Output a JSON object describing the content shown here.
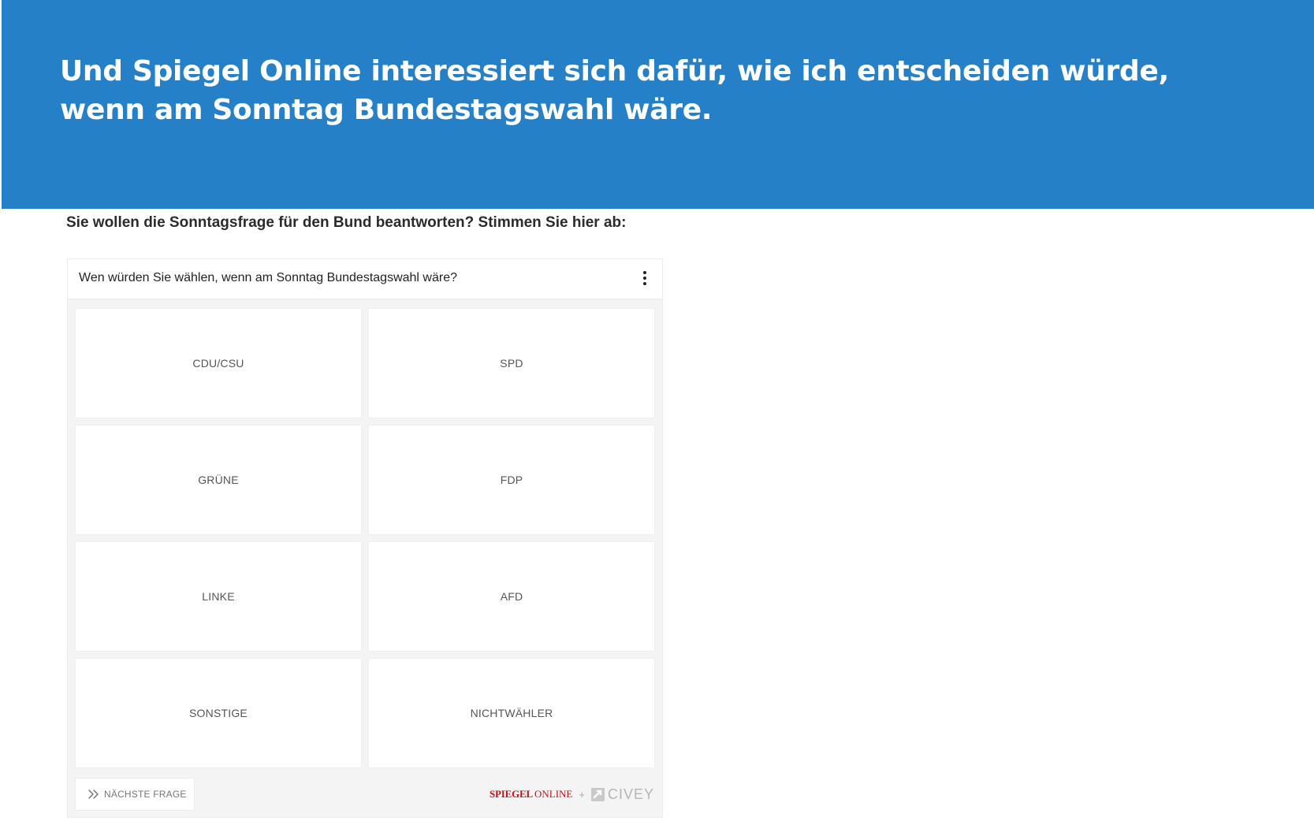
{
  "slide": {
    "title": "Und Spiegel Online interessiert sich dafür, wie ich entscheiden würde, wenn am Sonntag Bundestagswahl wäre.",
    "intro": "Sie wollen die Sonntagsfrage für den Bund beantworten? Stimmen Sie hier ab:",
    "banner_color": "#2580c8"
  },
  "poll": {
    "question": "Wen würden Sie wählen, wenn am Sonntag Bundestagswahl wäre?",
    "menu_icon": "more-vertical-icon",
    "options": [
      "CDU/CSU",
      "SPD",
      "GRÜNE",
      "FDP",
      "LINKE",
      "AFD",
      "SONSTIGE",
      "NICHTWÄHLER"
    ],
    "next_button": {
      "icon": "double-chevron-right-icon",
      "label": "NÄCHSTE FRAGE"
    },
    "branding": {
      "spiegel": "SPIEGEL",
      "online": "ONLINE",
      "separator": "+",
      "civey_icon": "civey-icon",
      "civey": "CIVEY",
      "brand_red": "#c4121a"
    }
  }
}
